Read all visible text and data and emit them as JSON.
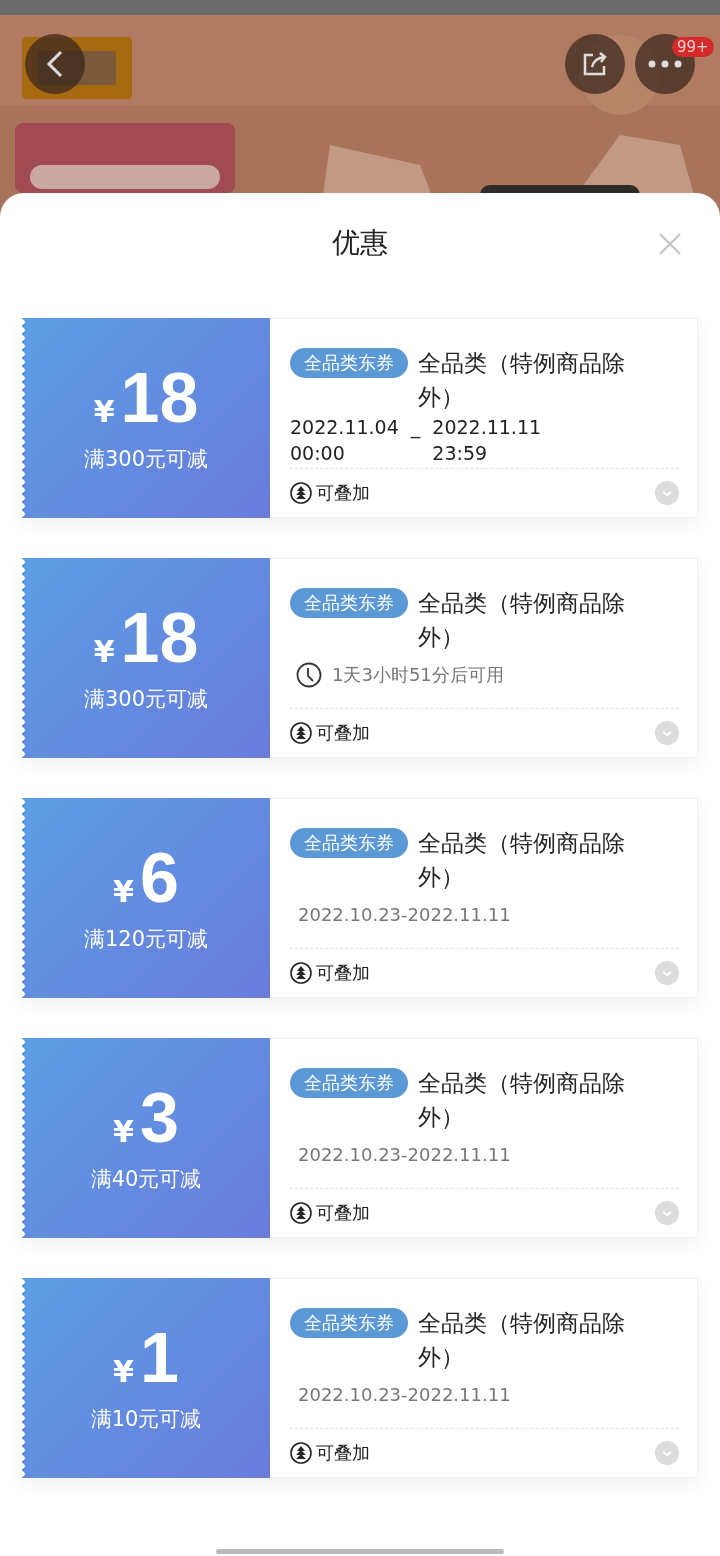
{
  "top_bar": {
    "badge": "99+"
  },
  "sheet": {
    "title": "优惠"
  },
  "coupons": [
    {
      "currency": "¥",
      "amount": "18",
      "condition": "满300元可减",
      "tag": "全品类东券",
      "title": "全品类（特例商品除外）",
      "validity": {
        "kind": "datetime",
        "start_date": "2022.11.04",
        "separator": "_",
        "end_date": "2022.11.11",
        "start_time": "00:00",
        "end_time": "23:59"
      },
      "stack_label": "可叠加"
    },
    {
      "currency": "¥",
      "amount": "18",
      "condition": "满300元可减",
      "tag": "全品类东券",
      "title": "全品类（特例商品除外）",
      "validity": {
        "kind": "countdown",
        "text": "1天3小时51分后可用"
      },
      "stack_label": "可叠加"
    },
    {
      "currency": "¥",
      "amount": "6",
      "condition": "满120元可减",
      "tag": "全品类东券",
      "title": "全品类（特例商品除外）",
      "validity": {
        "kind": "range",
        "text": "2022.10.23-2022.11.11"
      },
      "stack_label": "可叠加"
    },
    {
      "currency": "¥",
      "amount": "3",
      "condition": "满40元可减",
      "tag": "全品类东券",
      "title": "全品类（特例商品除外）",
      "validity": {
        "kind": "range",
        "text": "2022.10.23-2022.11.11"
      },
      "stack_label": "可叠加"
    },
    {
      "currency": "¥",
      "amount": "1",
      "condition": "满10元可减",
      "tag": "全品类东券",
      "title": "全品类（特例商品除外）",
      "validity": {
        "kind": "range",
        "text": "2022.10.23-2022.11.11"
      },
      "stack_label": "可叠加"
    }
  ]
}
